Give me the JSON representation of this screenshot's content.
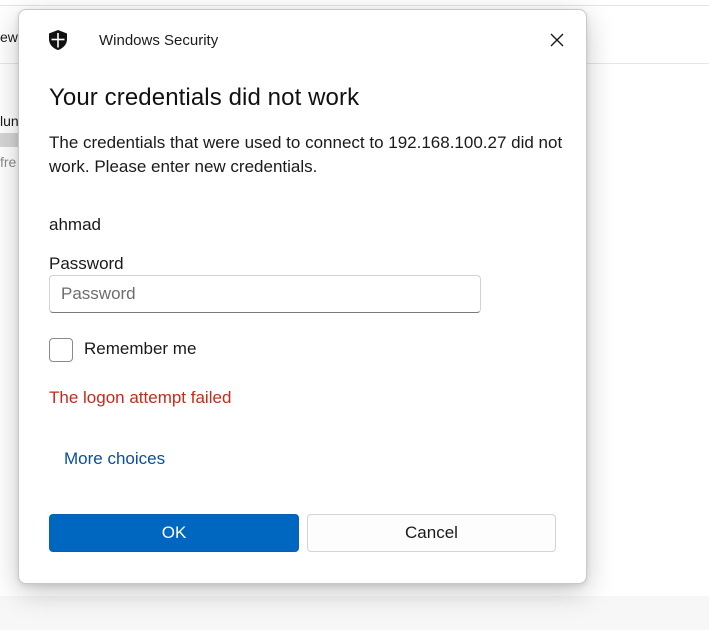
{
  "background": {
    "fragment_1": "ew",
    "fragment_2": "lun",
    "fragment_3": "fre"
  },
  "dialog": {
    "app_title": "Windows Security",
    "heading": "Your credentials did not work",
    "description": "The credentials that were used to connect to 192.168.100.27 did not work. Please enter new credentials.",
    "username": "ahmad",
    "password_label": "Password",
    "password_value": "",
    "password_placeholder": "Password",
    "remember_label": "Remember me",
    "remember_checked": false,
    "error_message": "The logon attempt failed",
    "more_choices": "More choices",
    "ok_label": "OK",
    "cancel_label": "Cancel"
  },
  "colors": {
    "accent": "#0067c0",
    "error": "#c42b1c",
    "link": "#0a4e9b"
  },
  "icons": {
    "app": "shield-icon",
    "close": "close-icon"
  }
}
